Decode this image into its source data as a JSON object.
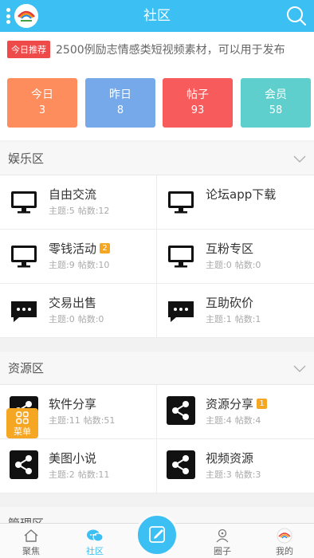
{
  "header": {
    "title": "社区"
  },
  "notice": {
    "tag": "今日推荐",
    "text": "2500例励志情感类短视频素材，可以用于发布"
  },
  "stats": [
    {
      "label": "今日",
      "value": "3",
      "color": "#fd8d5d"
    },
    {
      "label": "昨日",
      "value": "8",
      "color": "#76a9ea"
    },
    {
      "label": "帖子",
      "value": "93",
      "color": "#f75b5b"
    },
    {
      "label": "会员",
      "value": "58",
      "color": "#5ecfcc"
    }
  ],
  "sections": [
    {
      "title": "娱乐区",
      "forums": [
        {
          "name": "自由交流",
          "topics_label": "主题:5",
          "posts_label": "帖数:12",
          "icon": "monitor-icon"
        },
        {
          "name": "论坛app下载",
          "topics_label": "",
          "posts_label": "",
          "icon": "monitor-icon"
        },
        {
          "name": "零钱活动",
          "badge": "2",
          "topics_label": "主题:9",
          "posts_label": "帖数:10",
          "icon": "monitor-icon"
        },
        {
          "name": "互粉专区",
          "topics_label": "主题:0",
          "posts_label": "帖数:0",
          "icon": "monitor-icon"
        },
        {
          "name": "交易出售",
          "topics_label": "主题:0",
          "posts_label": "帖数:0",
          "icon": "chat-bubble-icon"
        },
        {
          "name": "互助砍价",
          "topics_label": "主题:1",
          "posts_label": "帖数:1",
          "icon": "chat-bubble-icon"
        }
      ]
    },
    {
      "title": "资源区",
      "forums": [
        {
          "name": "软件分享",
          "topics_label": "主题:11",
          "posts_label": "帖数:51",
          "icon": "share-icon"
        },
        {
          "name": "资源分享",
          "badge": "1",
          "topics_label": "主题:4",
          "posts_label": "帖数:4",
          "icon": "share-icon"
        },
        {
          "name": "美图小说",
          "topics_label": "主题:2",
          "posts_label": "帖数:11",
          "icon": "share-icon"
        },
        {
          "name": "视频资源",
          "topics_label": "主题:3",
          "posts_label": "帖数:3",
          "icon": "share-icon"
        }
      ]
    },
    {
      "title": "管理区"
    }
  ],
  "float_menu": {
    "label": "菜单"
  },
  "bottom_nav": [
    {
      "label": "聚焦",
      "icon": "home-icon"
    },
    {
      "label": "社区",
      "icon": "chat-icon",
      "active": true
    },
    {
      "label": "",
      "icon": "edit-icon"
    },
    {
      "label": "圈子",
      "icon": "circle-group-icon"
    },
    {
      "label": "我的",
      "icon": "profile-icon"
    }
  ],
  "colors": {
    "primary": "#3cbff3",
    "badge": "#f5a623",
    "notice_tag": "#ef4a4a"
  }
}
